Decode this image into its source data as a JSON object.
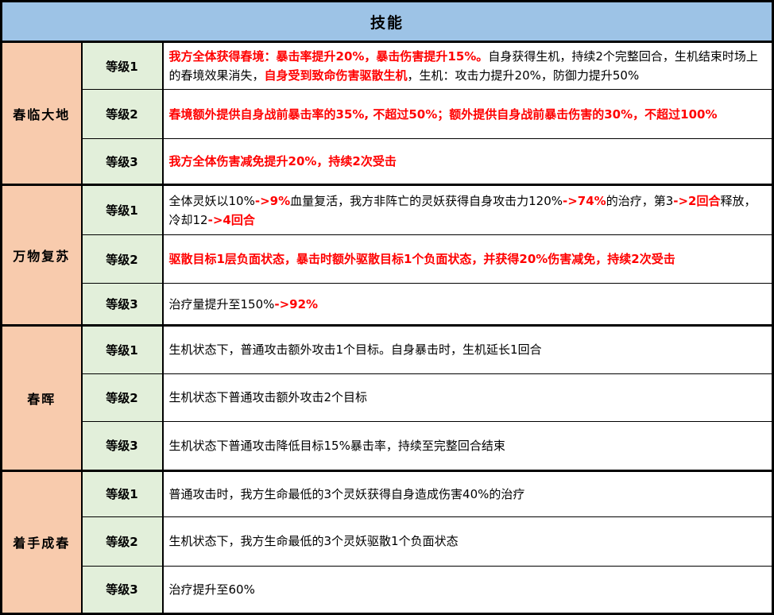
{
  "header": {
    "title": "技能"
  },
  "colors": {
    "header_bg": "#9DC3E6",
    "skill_name_bg": "#F8CBAD",
    "level_bg": "#E2EFDA",
    "description_bg": "#FFFFFF",
    "border": "#000000",
    "highlight_text": "#FF0000",
    "normal_text": "#000000"
  },
  "groups": [
    {
      "name": "春临大地",
      "levels": [
        {
          "label": "等级1",
          "segments": [
            {
              "text": "我方全体获得春境：暴击率提升20%，暴击伤害提升15%。",
              "color": "red"
            },
            {
              "text": "自身获得生机，持续2个完整回合，生机结束时场上的春境效果消失，",
              "color": "black"
            },
            {
              "text": "自身受到致命伤害驱散生机",
              "color": "red"
            },
            {
              "text": "，生机：攻击力提升20%，防御力提升50%",
              "color": "black"
            }
          ]
        },
        {
          "label": "等级2",
          "segments": [
            {
              "text": "春境额外提供自身战前暴击率的35%, 不超过50%；额外提供自身战前暴击伤害的30%，不超过100%",
              "color": "red"
            }
          ]
        },
        {
          "label": "等级3",
          "segments": [
            {
              "text": "我方全体伤害减免提升20%，持续2次受击",
              "color": "red"
            }
          ]
        }
      ]
    },
    {
      "name": "万物复苏",
      "levels": [
        {
          "label": "等级1",
          "segments": [
            {
              "text": "全体灵妖以10%",
              "color": "black"
            },
            {
              "text": "->9%",
              "color": "red"
            },
            {
              "text": "血量复活，我方非阵亡的灵妖获得自身攻击力120%",
              "color": "black"
            },
            {
              "text": "->74%",
              "color": "red"
            },
            {
              "text": "的治疗，第3",
              "color": "black"
            },
            {
              "text": "->2回合",
              "color": "red"
            },
            {
              "text": "释放，冷却12",
              "color": "black"
            },
            {
              "text": "->4回合",
              "color": "red"
            }
          ]
        },
        {
          "label": "等级2",
          "segments": [
            {
              "text": "驱散目标1层负面状态，暴击时额外驱散目标1个负面状态，并获得20%伤害减免，持续2次受击",
              "color": "red"
            }
          ]
        },
        {
          "label": "等级3",
          "segments": [
            {
              "text": "治疗量提升至150%",
              "color": "black"
            },
            {
              "text": "->92%",
              "color": "red"
            }
          ]
        }
      ]
    },
    {
      "name": "春晖",
      "levels": [
        {
          "label": "等级1",
          "segments": [
            {
              "text": "生机状态下，普通攻击额外攻击1个目标。自身暴击时，生机延长1回合",
              "color": "black"
            }
          ]
        },
        {
          "label": "等级2",
          "segments": [
            {
              "text": "生机状态下普通攻击额外攻击2个目标",
              "color": "black"
            }
          ]
        },
        {
          "label": "等级3",
          "segments": [
            {
              "text": "生机状态下普通攻击降低目标15%暴击率，持续至完整回合结束",
              "color": "black"
            }
          ]
        }
      ]
    },
    {
      "name": "着手成春",
      "levels": [
        {
          "label": "等级1",
          "segments": [
            {
              "text": "普通攻击时，我方生命最低的3个灵妖获得自身造成伤害40%的治疗",
              "color": "black"
            }
          ]
        },
        {
          "label": "等级2",
          "segments": [
            {
              "text": "生机状态下，我方生命最低的3个灵妖驱散1个负面状态",
              "color": "black"
            }
          ]
        },
        {
          "label": "等级3",
          "segments": [
            {
              "text": "治疗提升至60%",
              "color": "black"
            }
          ]
        }
      ]
    }
  ]
}
